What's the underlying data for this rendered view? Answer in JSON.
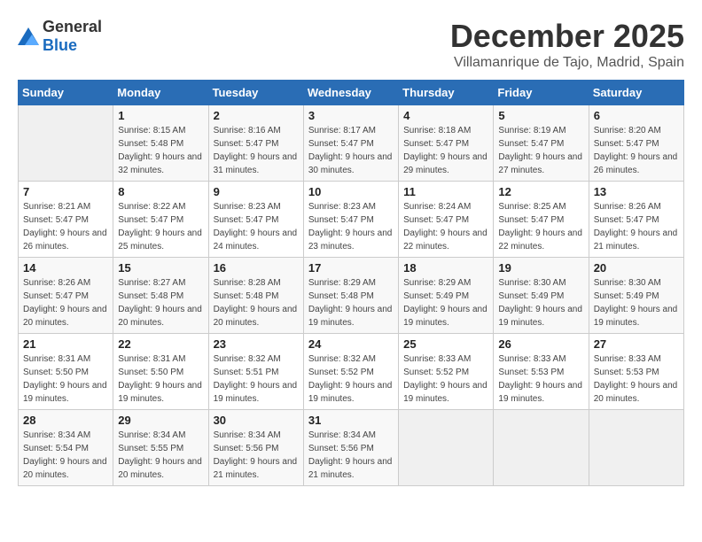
{
  "logo": {
    "general": "General",
    "blue": "Blue"
  },
  "header": {
    "month": "December 2025",
    "location": "Villamanrique de Tajo, Madrid, Spain"
  },
  "weekdays": [
    "Sunday",
    "Monday",
    "Tuesday",
    "Wednesday",
    "Thursday",
    "Friday",
    "Saturday"
  ],
  "weeks": [
    [
      {
        "day": "",
        "sunrise": "",
        "sunset": "",
        "daylight": ""
      },
      {
        "day": "1",
        "sunrise": "Sunrise: 8:15 AM",
        "sunset": "Sunset: 5:48 PM",
        "daylight": "Daylight: 9 hours and 32 minutes."
      },
      {
        "day": "2",
        "sunrise": "Sunrise: 8:16 AM",
        "sunset": "Sunset: 5:47 PM",
        "daylight": "Daylight: 9 hours and 31 minutes."
      },
      {
        "day": "3",
        "sunrise": "Sunrise: 8:17 AM",
        "sunset": "Sunset: 5:47 PM",
        "daylight": "Daylight: 9 hours and 30 minutes."
      },
      {
        "day": "4",
        "sunrise": "Sunrise: 8:18 AM",
        "sunset": "Sunset: 5:47 PM",
        "daylight": "Daylight: 9 hours and 29 minutes."
      },
      {
        "day": "5",
        "sunrise": "Sunrise: 8:19 AM",
        "sunset": "Sunset: 5:47 PM",
        "daylight": "Daylight: 9 hours and 27 minutes."
      },
      {
        "day": "6",
        "sunrise": "Sunrise: 8:20 AM",
        "sunset": "Sunset: 5:47 PM",
        "daylight": "Daylight: 9 hours and 26 minutes."
      }
    ],
    [
      {
        "day": "7",
        "sunrise": "Sunrise: 8:21 AM",
        "sunset": "Sunset: 5:47 PM",
        "daylight": "Daylight: 9 hours and 26 minutes."
      },
      {
        "day": "8",
        "sunrise": "Sunrise: 8:22 AM",
        "sunset": "Sunset: 5:47 PM",
        "daylight": "Daylight: 9 hours and 25 minutes."
      },
      {
        "day": "9",
        "sunrise": "Sunrise: 8:23 AM",
        "sunset": "Sunset: 5:47 PM",
        "daylight": "Daylight: 9 hours and 24 minutes."
      },
      {
        "day": "10",
        "sunrise": "Sunrise: 8:23 AM",
        "sunset": "Sunset: 5:47 PM",
        "daylight": "Daylight: 9 hours and 23 minutes."
      },
      {
        "day": "11",
        "sunrise": "Sunrise: 8:24 AM",
        "sunset": "Sunset: 5:47 PM",
        "daylight": "Daylight: 9 hours and 22 minutes."
      },
      {
        "day": "12",
        "sunrise": "Sunrise: 8:25 AM",
        "sunset": "Sunset: 5:47 PM",
        "daylight": "Daylight: 9 hours and 22 minutes."
      },
      {
        "day": "13",
        "sunrise": "Sunrise: 8:26 AM",
        "sunset": "Sunset: 5:47 PM",
        "daylight": "Daylight: 9 hours and 21 minutes."
      }
    ],
    [
      {
        "day": "14",
        "sunrise": "Sunrise: 8:26 AM",
        "sunset": "Sunset: 5:47 PM",
        "daylight": "Daylight: 9 hours and 20 minutes."
      },
      {
        "day": "15",
        "sunrise": "Sunrise: 8:27 AM",
        "sunset": "Sunset: 5:48 PM",
        "daylight": "Daylight: 9 hours and 20 minutes."
      },
      {
        "day": "16",
        "sunrise": "Sunrise: 8:28 AM",
        "sunset": "Sunset: 5:48 PM",
        "daylight": "Daylight: 9 hours and 20 minutes."
      },
      {
        "day": "17",
        "sunrise": "Sunrise: 8:29 AM",
        "sunset": "Sunset: 5:48 PM",
        "daylight": "Daylight: 9 hours and 19 minutes."
      },
      {
        "day": "18",
        "sunrise": "Sunrise: 8:29 AM",
        "sunset": "Sunset: 5:49 PM",
        "daylight": "Daylight: 9 hours and 19 minutes."
      },
      {
        "day": "19",
        "sunrise": "Sunrise: 8:30 AM",
        "sunset": "Sunset: 5:49 PM",
        "daylight": "Daylight: 9 hours and 19 minutes."
      },
      {
        "day": "20",
        "sunrise": "Sunrise: 8:30 AM",
        "sunset": "Sunset: 5:49 PM",
        "daylight": "Daylight: 9 hours and 19 minutes."
      }
    ],
    [
      {
        "day": "21",
        "sunrise": "Sunrise: 8:31 AM",
        "sunset": "Sunset: 5:50 PM",
        "daylight": "Daylight: 9 hours and 19 minutes."
      },
      {
        "day": "22",
        "sunrise": "Sunrise: 8:31 AM",
        "sunset": "Sunset: 5:50 PM",
        "daylight": "Daylight: 9 hours and 19 minutes."
      },
      {
        "day": "23",
        "sunrise": "Sunrise: 8:32 AM",
        "sunset": "Sunset: 5:51 PM",
        "daylight": "Daylight: 9 hours and 19 minutes."
      },
      {
        "day": "24",
        "sunrise": "Sunrise: 8:32 AM",
        "sunset": "Sunset: 5:52 PM",
        "daylight": "Daylight: 9 hours and 19 minutes."
      },
      {
        "day": "25",
        "sunrise": "Sunrise: 8:33 AM",
        "sunset": "Sunset: 5:52 PM",
        "daylight": "Daylight: 9 hours and 19 minutes."
      },
      {
        "day": "26",
        "sunrise": "Sunrise: 8:33 AM",
        "sunset": "Sunset: 5:53 PM",
        "daylight": "Daylight: 9 hours and 19 minutes."
      },
      {
        "day": "27",
        "sunrise": "Sunrise: 8:33 AM",
        "sunset": "Sunset: 5:53 PM",
        "daylight": "Daylight: 9 hours and 20 minutes."
      }
    ],
    [
      {
        "day": "28",
        "sunrise": "Sunrise: 8:34 AM",
        "sunset": "Sunset: 5:54 PM",
        "daylight": "Daylight: 9 hours and 20 minutes."
      },
      {
        "day": "29",
        "sunrise": "Sunrise: 8:34 AM",
        "sunset": "Sunset: 5:55 PM",
        "daylight": "Daylight: 9 hours and 20 minutes."
      },
      {
        "day": "30",
        "sunrise": "Sunrise: 8:34 AM",
        "sunset": "Sunset: 5:56 PM",
        "daylight": "Daylight: 9 hours and 21 minutes."
      },
      {
        "day": "31",
        "sunrise": "Sunrise: 8:34 AM",
        "sunset": "Sunset: 5:56 PM",
        "daylight": "Daylight: 9 hours and 21 minutes."
      },
      {
        "day": "",
        "sunrise": "",
        "sunset": "",
        "daylight": ""
      },
      {
        "day": "",
        "sunrise": "",
        "sunset": "",
        "daylight": ""
      },
      {
        "day": "",
        "sunrise": "",
        "sunset": "",
        "daylight": ""
      }
    ]
  ]
}
